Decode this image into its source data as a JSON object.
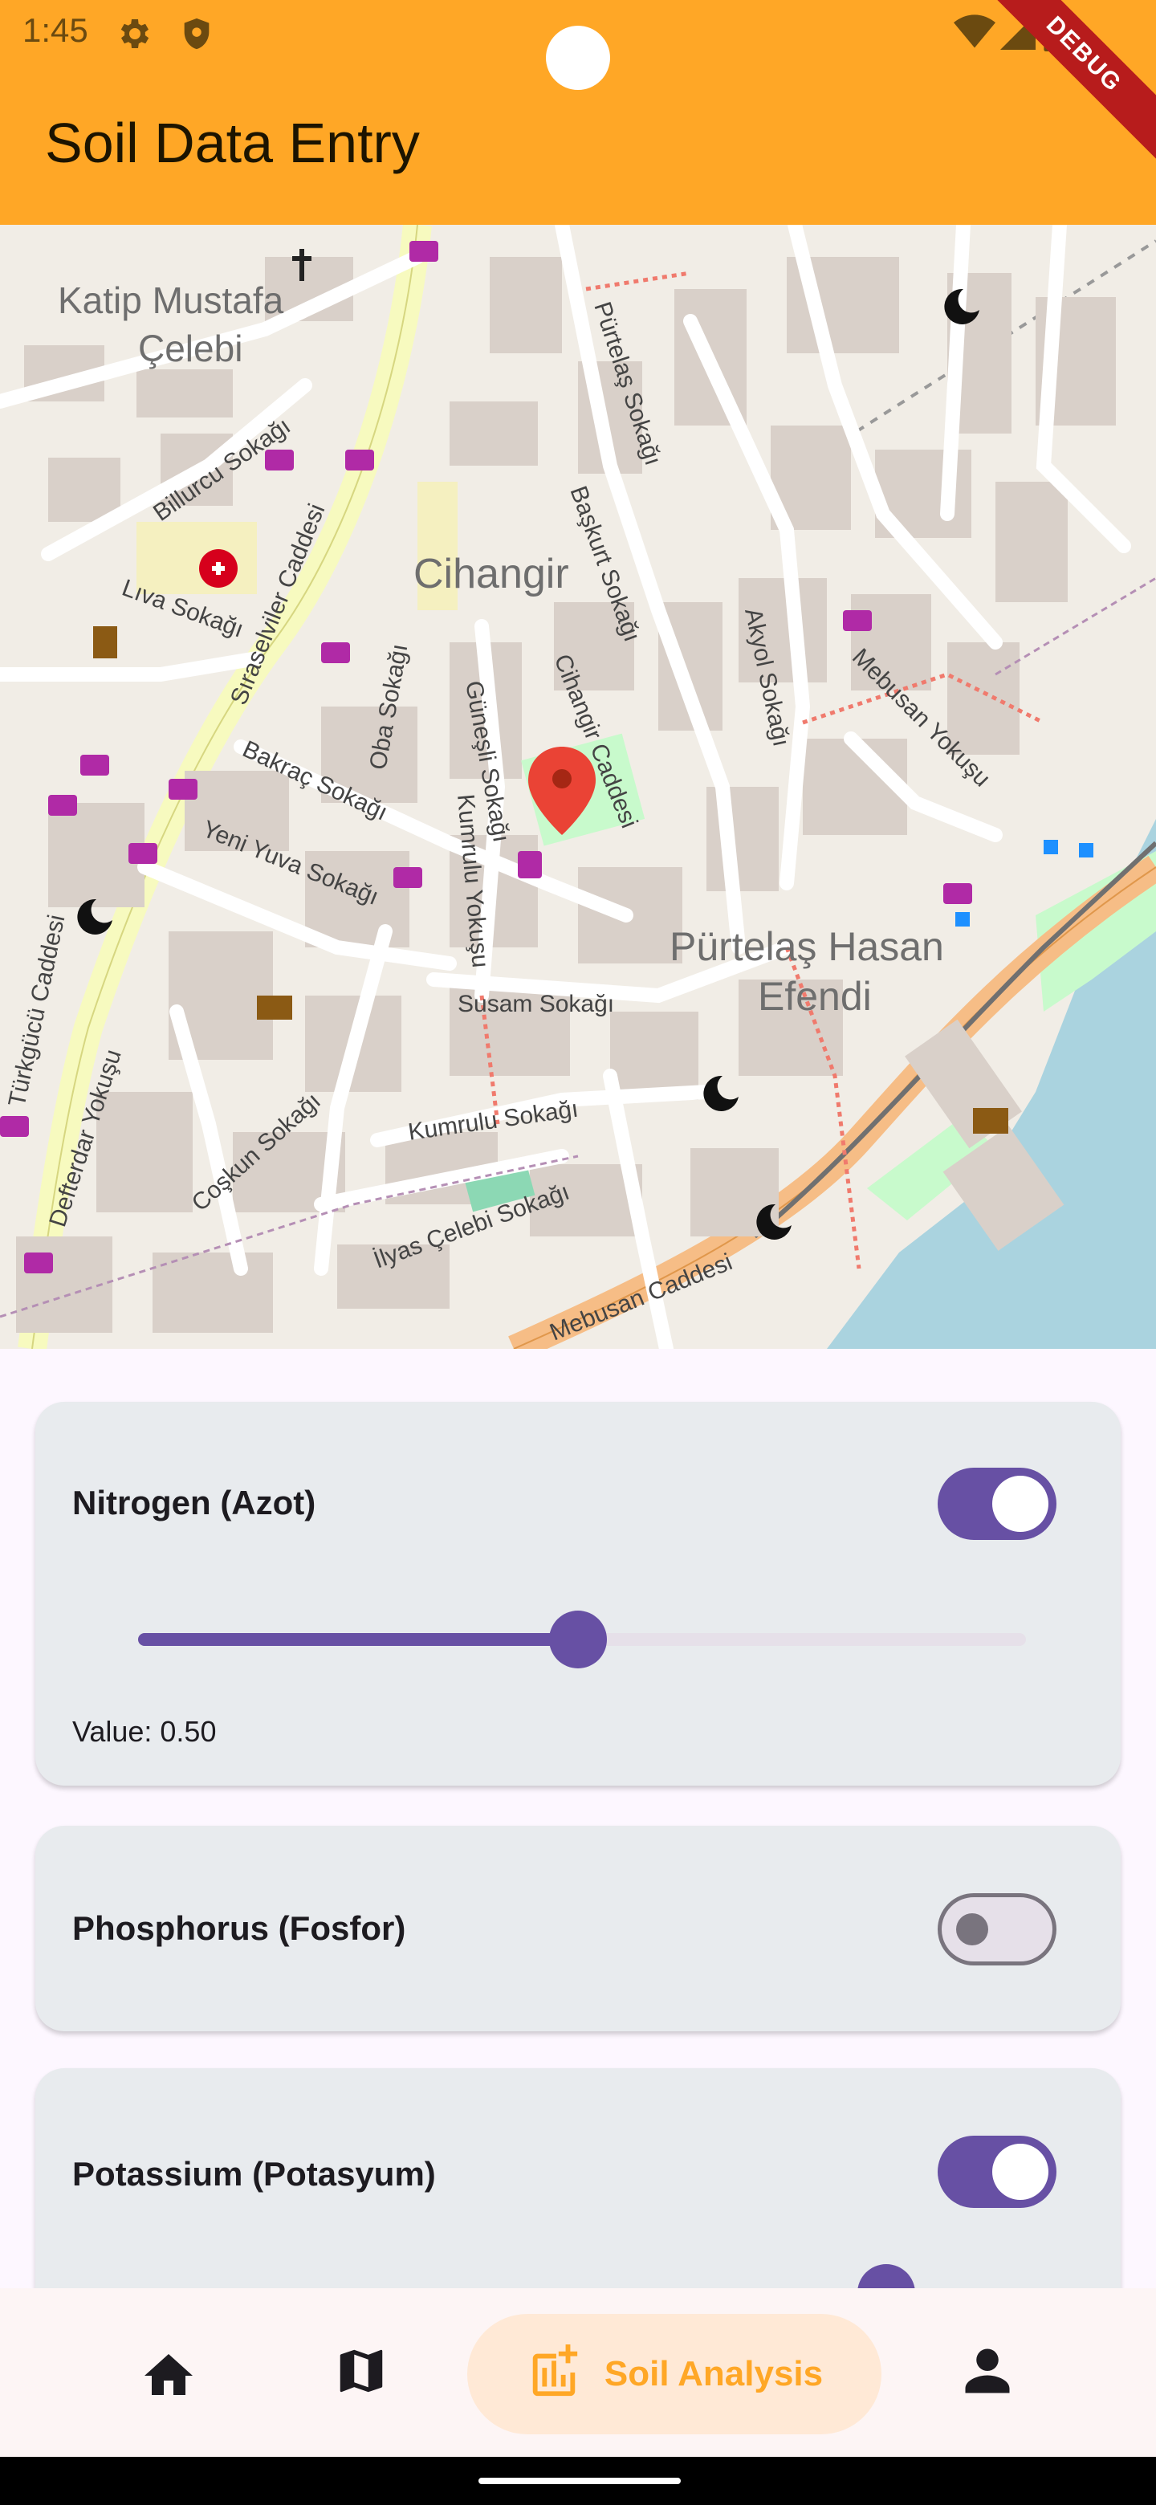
{
  "status_bar": {
    "time": "1:45",
    "icons": [
      "settings-icon",
      "shield-icon",
      "wifi-icon",
      "signal-icon",
      "battery-icon"
    ],
    "debug_label": "DEBUG"
  },
  "app_bar": {
    "title": "Soil Data Entry",
    "background_color": "#ffa726"
  },
  "map": {
    "labels": [
      {
        "text": "Katip Mustafa"
      },
      {
        "text": "Çelebi"
      },
      {
        "text": "Cihangir"
      },
      {
        "text": "Pürtelaş Hasan"
      },
      {
        "text": "Efendi"
      },
      {
        "text": "Sıraselviler Caddesi"
      },
      {
        "text": "Defterdar Yokuşu"
      },
      {
        "text": "Bakraç Sokağı"
      },
      {
        "text": "Yeni Yuva Sokağı"
      },
      {
        "text": "Susam Sokağı"
      },
      {
        "text": "Kumrulu Sokağı"
      },
      {
        "text": "Coşkun Sokağı"
      },
      {
        "text": "İlyas Çelebi Sokağı"
      },
      {
        "text": "Mebusan Caddesi"
      },
      {
        "text": "Cihangir Caddesi"
      },
      {
        "text": "Başkurt Sokağı"
      },
      {
        "text": "Pürtelaş Sokağı"
      },
      {
        "text": "Akyol Sokağı"
      },
      {
        "text": "Mebusan Yokuşu"
      },
      {
        "text": "Güneşli Sokağı"
      },
      {
        "text": "Kumrulu Yokuşu"
      },
      {
        "text": "Oba Sokağı"
      },
      {
        "text": "Lıva Sokağı"
      },
      {
        "text": "Billurcu Sokağı"
      },
      {
        "text": "Türkgücü Caddesi"
      }
    ],
    "marker": "location-pin-icon"
  },
  "cards": [
    {
      "title": "Nitrogen (Azot)",
      "enabled": true,
      "value_label": "Value: 0.50",
      "slider_value": 0.5
    },
    {
      "title": "Phosphorus (Fosfor)",
      "enabled": false
    },
    {
      "title": "Potassium (Potasyum)",
      "enabled": true
    }
  ],
  "bottom_nav": {
    "items": [
      {
        "icon": "home-icon"
      },
      {
        "icon": "map-icon"
      },
      {
        "icon": "soil-analysis-icon",
        "label": "Soil Analysis",
        "selected": true
      },
      {
        "icon": "person-icon"
      }
    ]
  },
  "colors": {
    "accent": "#6750a4",
    "nav_selected": "#ffa726"
  }
}
